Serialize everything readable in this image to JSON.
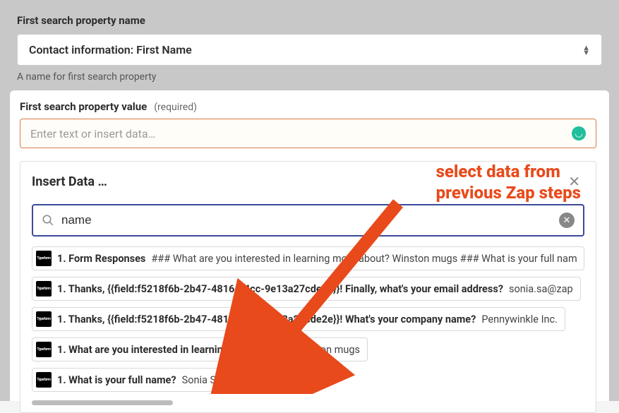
{
  "background": {
    "field1": {
      "label": "First search property name",
      "value": "Contact information: First Name",
      "help": "A name for first search property"
    }
  },
  "panel": {
    "field_label": "First search property value",
    "required_text": "(required)",
    "input": {
      "placeholder": "Enter text or insert data…"
    }
  },
  "dropdown": {
    "title": "Insert Data …",
    "search_value": "name",
    "results": [
      {
        "label": "1. Form Responses",
        "value": "### What are you interested in learning more about? Winston mugs ### What is your full nam"
      },
      {
        "label": "1. Thanks, {{field:f5218f6b-2b47-4816-a4cc-9e13a27cde2e}}! Finally, what's your email address?",
        "value": "sonia.sa@zap"
      },
      {
        "label": "1. Thanks, {{field:f5218f6b-2b47-4816-a4cc-9e13a27cde2e}}! What's your company name?",
        "value": "Pennywinkle Inc."
      },
      {
        "label": "1. What are you interested in learning more about?",
        "value": "Winston mugs"
      },
      {
        "label": "1. What is your full name?",
        "value": "Sonia Sá"
      }
    ]
  },
  "annotation": {
    "line1": "select data from",
    "line2": "previous Zap steps"
  },
  "icons": {
    "typeform_abbrev": "Typeform"
  }
}
